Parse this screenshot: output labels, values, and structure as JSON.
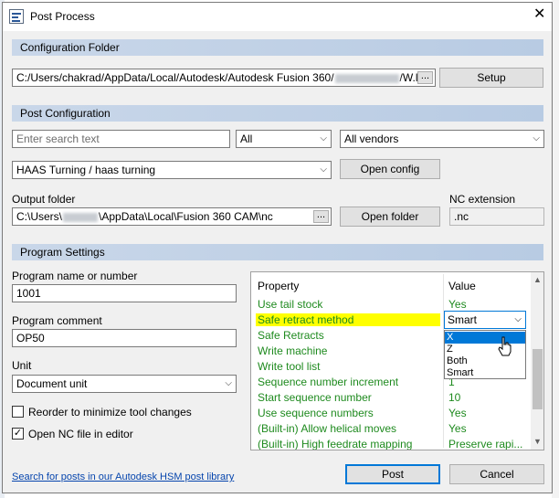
{
  "window": {
    "title": "Post Process",
    "close_symbol": "✕"
  },
  "config_folder": {
    "header": "Configuration Folder",
    "path_start": "C:/Users/chakrad/AppData/Local/Autodesk/Autodesk Fusion 360/",
    "path_end": "/W.lc",
    "browse_label": "...",
    "setup_label": "Setup"
  },
  "post_config": {
    "header": "Post Configuration",
    "search_placeholder": "Enter search text",
    "filter_value": "All",
    "vendor_value": "All vendors",
    "post_value": "HAAS Turning / haas turning",
    "open_config_label": "Open config",
    "output_folder_label": "Output folder",
    "output_path_start": "C:\\Users\\",
    "output_path_end": "\\AppData\\Local\\Fusion 360 CAM\\nc",
    "browse_label": "...",
    "open_folder_label": "Open folder",
    "nc_ext_label": "NC extension",
    "nc_ext_value": ".nc"
  },
  "program_settings": {
    "header": "Program Settings",
    "name_label": "Program name or number",
    "name_value": "1001",
    "comment_label": "Program comment",
    "comment_value": "OP50",
    "unit_label": "Unit",
    "unit_value": "Document unit",
    "reorder_label": "Reorder to minimize tool changes",
    "reorder_checked": false,
    "open_nc_label": "Open NC file in editor",
    "open_nc_checked": true,
    "check_mark": "✓"
  },
  "properties": {
    "col_property": "Property",
    "col_value": "Value",
    "rows": [
      {
        "property": "Use tail stock",
        "value": "Yes"
      },
      {
        "property": "Safe retract method",
        "value": "Smart"
      },
      {
        "property": "Safe Retracts",
        "value": ""
      },
      {
        "property": "Write machine",
        "value": ""
      },
      {
        "property": "Write tool list",
        "value": ""
      },
      {
        "property": "Sequence number increment",
        "value": "1"
      },
      {
        "property": "Start sequence number",
        "value": "10"
      },
      {
        "property": "Use sequence numbers",
        "value": "Yes"
      },
      {
        "property": "(Built-in) Allow helical moves",
        "value": "Yes"
      },
      {
        "property": "(Built-in) High feedrate mapping",
        "value": "Preserve rapi..."
      }
    ],
    "dropdown": {
      "value": "Smart",
      "options": [
        "X",
        "Z",
        "Both",
        "Smart"
      ],
      "highlighted": "X"
    }
  },
  "footer": {
    "link_text": "Search for posts in our Autodesk HSM post library",
    "post_label": "Post",
    "cancel_label": "Cancel"
  },
  "colors": {
    "section_header": "#c3d3e8",
    "property_text": "#1e8a1e",
    "highlight": "#ffff00",
    "selection": "#0078d7"
  }
}
